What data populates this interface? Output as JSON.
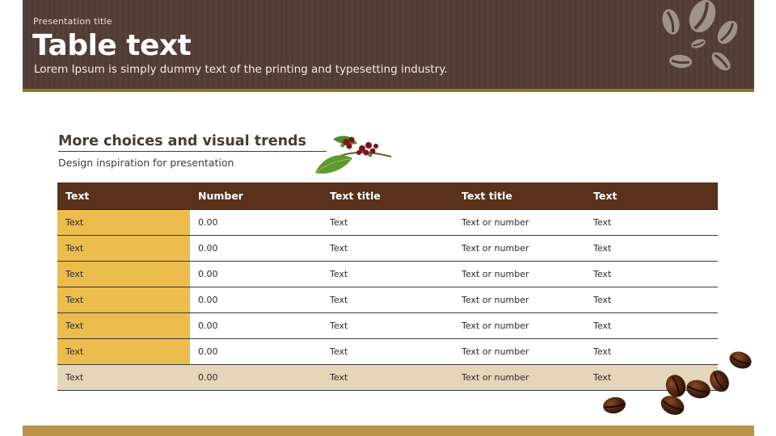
{
  "header": {
    "presentation_title": "Presentation title",
    "title": "Table text",
    "subtitle": "Lorem Ipsum is simply dummy text of the printing and typesetting industry."
  },
  "section": {
    "heading": "More choices and visual trends",
    "subheading": "Design inspiration for presentation"
  },
  "table": {
    "columns": [
      "Text",
      "Number",
      "Text title",
      "Text title",
      "Text"
    ],
    "rows": [
      [
        "Text",
        "0.00",
        "Text",
        "Text or number",
        "Text"
      ],
      [
        "Text",
        "0.00",
        "Text",
        "Text or number",
        "Text"
      ],
      [
        "Text",
        "0.00",
        "Text",
        "Text or number",
        "Text"
      ],
      [
        "Text",
        "0.00",
        "Text",
        "Text or number",
        "Text"
      ],
      [
        "Text",
        "0.00",
        "Text",
        "Text or number",
        "Text"
      ],
      [
        "Text",
        "0.00",
        "Text",
        "Text or number",
        "Text"
      ],
      [
        "Text",
        "0.00",
        "Text",
        "Text or number",
        "Text"
      ]
    ]
  },
  "colors": {
    "header_bg": "#523e36",
    "header_rule": "#8a7b22",
    "table_header": "#5a321c",
    "first_column": "#ecbc4c",
    "last_row": "#e5d6bb",
    "footer": "#b89349"
  },
  "decorations": [
    "coffee-bean-outline-icons",
    "coffee-berries-branch",
    "coffee-beans-image"
  ]
}
